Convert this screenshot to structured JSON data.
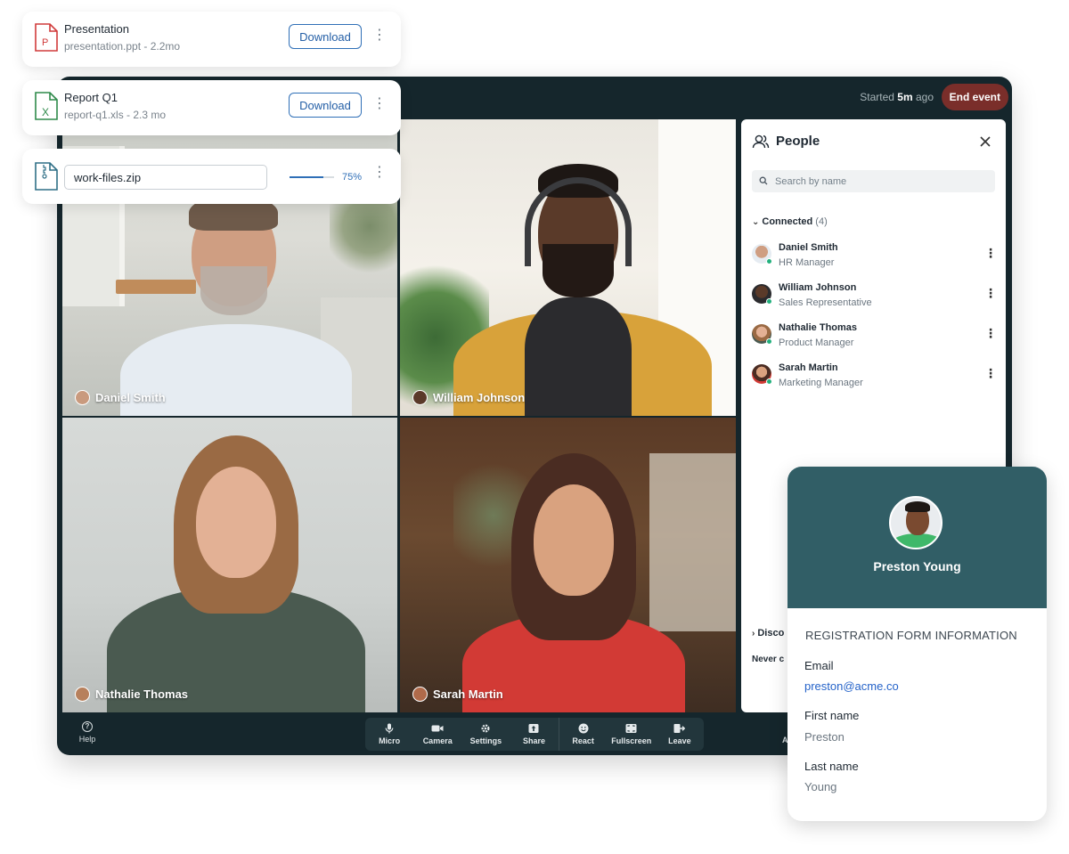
{
  "header": {
    "started_prefix": "Started",
    "started_value": "5m",
    "started_suffix": "ago",
    "end_event_label": "End event"
  },
  "participants": [
    {
      "name": "Daniel Smith",
      "role": "HR Manager"
    },
    {
      "name": "William Johnson",
      "role": "Sales Representative"
    },
    {
      "name": "Nathalie Thomas",
      "role": "Product Manager"
    },
    {
      "name": "Sarah Martin",
      "role": "Marketing Manager"
    }
  ],
  "people_panel": {
    "title": "People",
    "search_placeholder": "Search by name",
    "connected_label": "Connected",
    "connected_count": "(4)",
    "disconnected_label": "Disco",
    "never_text": "Never c"
  },
  "toolbar": {
    "help_label": "Help",
    "items": [
      "Micro",
      "Camera",
      "Settings",
      "Share",
      "React",
      "Fullscreen",
      "Leave"
    ],
    "right_label": "A"
  },
  "files": [
    {
      "title": "Presentation",
      "meta": "presentation.ppt -  2.2mo",
      "action": "Download",
      "icon": "ppt-file-icon"
    },
    {
      "title": "Report Q1",
      "meta": "report-q1.xls - 2.3 mo",
      "action": "Download",
      "icon": "xls-file-icon"
    }
  ],
  "upload": {
    "filename": "work-files.zip",
    "progress": 0.75,
    "progress_text": "75%",
    "icon": "zip-file-icon"
  },
  "profile": {
    "name": "Preston Young",
    "section_title": "REGISTRATION FORM INFORMATION",
    "fields": [
      {
        "label": "Email",
        "value": "preston@acme.co"
      },
      {
        "label": "First name",
        "value": "Preston"
      },
      {
        "label": "Last name",
        "value": "Young"
      }
    ]
  },
  "colors": {
    "window_bg": "#15262c",
    "end_event": "#7a2e2a",
    "accent_blue": "#2f6fb7",
    "profile_header": "#315e66",
    "online_dot": "#22b07d"
  }
}
